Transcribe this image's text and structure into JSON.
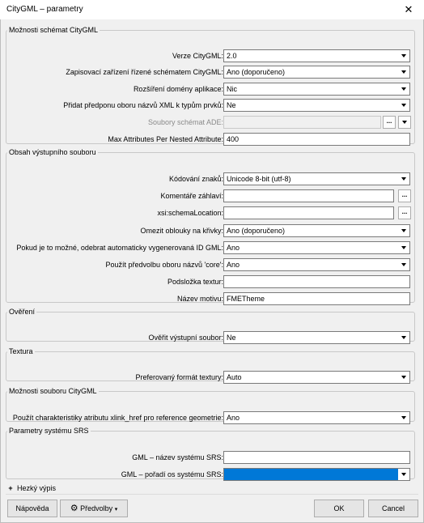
{
  "window": {
    "title": "CityGML – parametry",
    "close_icon": "close-icon"
  },
  "groups": {
    "schema": {
      "legend": "Možnosti schémat CityGML",
      "version": {
        "label": "Verze CityGML:",
        "value": "2.0"
      },
      "writer": {
        "label": "Zapisovací zařízení řízené schématem CityGML:",
        "value": "Ano (doporučeno)"
      },
      "ade": {
        "label": "Rozšíření domény aplikace:",
        "value": "Nic"
      },
      "prefix": {
        "label": "Přidat předponu oboru názvů XML k typům prvků:",
        "value": "Ne"
      },
      "ade_files": {
        "label": "Soubory schémat ADE:",
        "value": "",
        "dots": "..."
      },
      "max_attrs": {
        "label": "Max Attributes Per Nested Attribute:",
        "value": "400"
      }
    },
    "output": {
      "legend": "Obsah výstupního souboru",
      "encoding": {
        "label": "Kódování znaků:",
        "value": "Unicode 8-bit (utf-8)"
      },
      "comments": {
        "label": "Komentáře záhlaví:",
        "value": "",
        "dots": "..."
      },
      "schemaloc": {
        "label": "xsi:schemaLocation:",
        "value": "",
        "dots": "..."
      },
      "arcs": {
        "label": "Omezit oblouky na křivky:",
        "value": "Ano (doporučeno)"
      },
      "remove_ids": {
        "label": "Pokud je to možné, odebrat automaticky vygenerovaná ID GML:",
        "value": "Ano"
      },
      "core_ns": {
        "label": "Použít předvolbu oboru názvů 'core':",
        "value": "Ano"
      },
      "tex_subfolder": {
        "label": "Podsložka textur:",
        "value": ""
      },
      "theme": {
        "label": "Název motivu:",
        "value": "FMETheme"
      }
    },
    "validation": {
      "legend": "Ověření",
      "validate": {
        "label": "Ověřit výstupní soubor:",
        "value": "Ne"
      }
    },
    "texture": {
      "legend": "Textura",
      "format": {
        "label": "Preferovaný formát textury:",
        "value": "Auto"
      }
    },
    "file_opts": {
      "legend": "Možnosti souboru CityGML",
      "xlink": {
        "label": "Použít charakteristiky atributu xlink_href pro reference geometrie:",
        "value": "Ano"
      }
    },
    "srs": {
      "legend": "Parametry systému SRS",
      "name": {
        "label": "GML – název systému SRS:",
        "value": ""
      },
      "axis": {
        "label": "GML – pořadí os systému SRS:",
        "value": ""
      }
    }
  },
  "expander": {
    "label": "Hezký výpis",
    "icon": "expand-plus-icon"
  },
  "buttons": {
    "help": "Nápověda",
    "presets": "Předvolby",
    "ok": "OK",
    "cancel": "Cancel"
  },
  "colors": {
    "selection": "#0078d7",
    "background": "#f0f0f0"
  }
}
